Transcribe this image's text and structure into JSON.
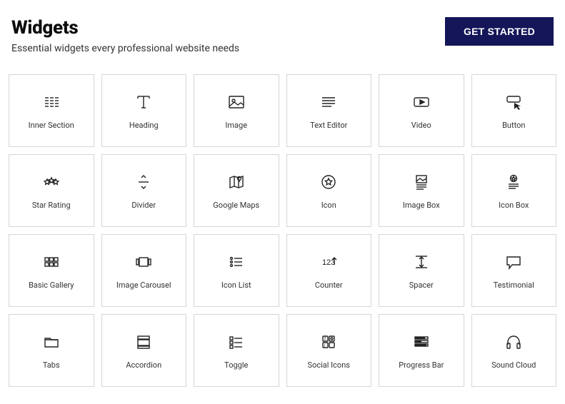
{
  "header": {
    "title": "Widgets",
    "subtitle": "Essential widgets every professional website needs",
    "cta_label": "GET STARTED"
  },
  "widgets": [
    {
      "id": "inner-section",
      "label": "Inner Section"
    },
    {
      "id": "heading",
      "label": "Heading"
    },
    {
      "id": "image",
      "label": "Image"
    },
    {
      "id": "text-editor",
      "label": "Text Editor"
    },
    {
      "id": "video",
      "label": "Video"
    },
    {
      "id": "button",
      "label": "Button"
    },
    {
      "id": "star-rating",
      "label": "Star Rating"
    },
    {
      "id": "divider",
      "label": "Divider"
    },
    {
      "id": "google-maps",
      "label": "Google Maps"
    },
    {
      "id": "icon",
      "label": "Icon"
    },
    {
      "id": "image-box",
      "label": "Image Box"
    },
    {
      "id": "icon-box",
      "label": "Icon Box"
    },
    {
      "id": "basic-gallery",
      "label": "Basic Gallery"
    },
    {
      "id": "image-carousel",
      "label": "Image Carousel"
    },
    {
      "id": "icon-list",
      "label": "Icon List"
    },
    {
      "id": "counter",
      "label": "Counter"
    },
    {
      "id": "spacer",
      "label": "Spacer"
    },
    {
      "id": "testimonial",
      "label": "Testimonial"
    },
    {
      "id": "tabs",
      "label": "Tabs"
    },
    {
      "id": "accordion",
      "label": "Accordion"
    },
    {
      "id": "toggle",
      "label": "Toggle"
    },
    {
      "id": "social-icons",
      "label": "Social Icons"
    },
    {
      "id": "progress-bar",
      "label": "Progress Bar"
    },
    {
      "id": "sound-cloud",
      "label": "Sound Cloud"
    }
  ]
}
